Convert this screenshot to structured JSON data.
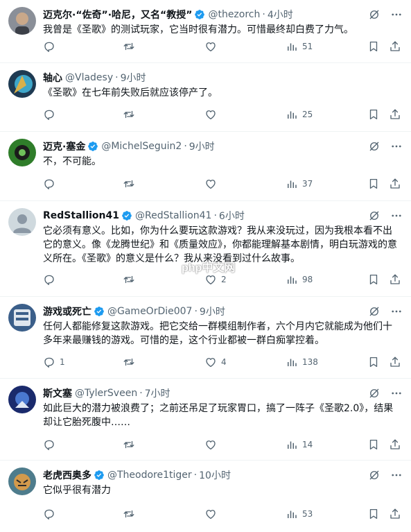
{
  "colors": {
    "text": "#0f1419",
    "muted": "#536471",
    "verified": "#1d9bf0",
    "divider": "#eff3f4"
  },
  "icons": {
    "verified": "verified-badge-icon",
    "grok": "grok-icon",
    "more": "more-icon",
    "reply": "reply-icon",
    "retweet": "retweet-icon",
    "like": "like-icon",
    "views": "views-icon",
    "bookmark": "bookmark-icon",
    "share": "share-icon"
  },
  "watermark": "php中文网",
  "tweets": [
    {
      "name": "迈克尔·“佐奇”·哈尼，又名“教授”",
      "verified": true,
      "handle": "@thezorch",
      "dot": "·",
      "time": "4小时",
      "text": "我曾是《圣歌》的测试玩家，它当时很有潜力。可惜最终却白费了力气。",
      "replies": "",
      "retweets": "",
      "likes": "",
      "views": "51"
    },
    {
      "name": "轴心",
      "verified": false,
      "handle": "@Vladesy",
      "dot": "·",
      "time": "9小时",
      "text": "《圣歌》在七年前失败后就应该停产了。",
      "replies": "",
      "retweets": "",
      "likes": "",
      "views": "25"
    },
    {
      "name": "迈克·塞金",
      "verified": true,
      "handle": "@MichelSeguin2",
      "dot": "·",
      "time": "9小时",
      "text": "不，不可能。",
      "replies": "",
      "retweets": "",
      "likes": "",
      "views": "37"
    },
    {
      "name": "RedStallion41",
      "verified": true,
      "handle": "@RedStallion41",
      "dot": "·",
      "time": "6小时",
      "text": "它必须有意义。比如，你为什么要玩这款游戏？我从来没玩过，因为我根本看不出它的意义。像《龙腾世纪》和《质量效应》，你都能理解基本剧情，明白玩游戏的意义所在。《圣歌》的意义是什么？我从来没看到过什么故事。",
      "replies": "",
      "retweets": "",
      "likes": "2",
      "views": "98"
    },
    {
      "name": "游戏或死亡",
      "verified": true,
      "handle": "@GameOrDie007",
      "dot": "·",
      "time": "9小时",
      "text": "任何人都能修复这款游戏。把它交给一群模组制作者，六个月内它就能成为他们十多年来最赚钱的游戏。可惜的是，这个行业都被一群白痴掌控着。",
      "replies": "1",
      "retweets": "",
      "likes": "4",
      "views": "138"
    },
    {
      "name": "斯文塞",
      "verified": false,
      "handle": "@TylerSveen",
      "dot": "·",
      "time": "7小时",
      "text": "如此巨大的潜力被浪费了；之前还吊足了玩家胃口，搞了一阵子《圣歌2.0》，结果却让它胎死腹中……",
      "replies": "",
      "retweets": "",
      "likes": "",
      "views": "14"
    },
    {
      "name": "老虎西奥多",
      "verified": true,
      "handle": "@Theodore1tiger",
      "dot": "·",
      "time": "10小时",
      "text": "它似乎很有潜力",
      "replies": "",
      "retweets": "",
      "likes": "",
      "views": "53"
    }
  ]
}
